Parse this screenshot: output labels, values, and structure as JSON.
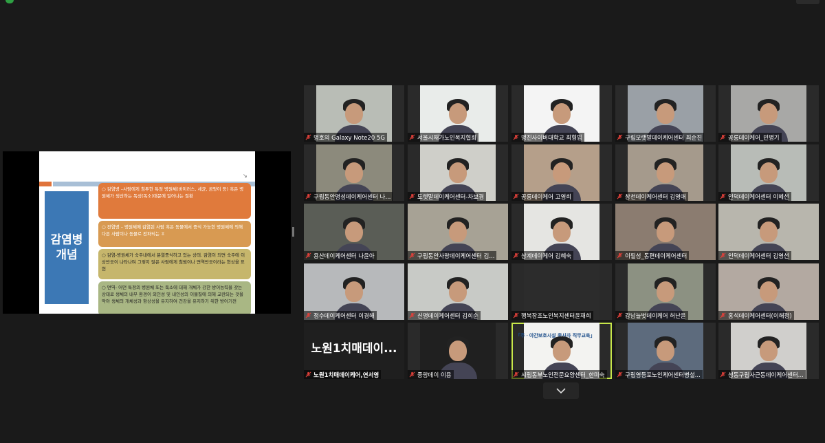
{
  "slide": {
    "title": "감염병\n개념",
    "bullets": [
      "○ 감염병 –사람에게 침투한 특정 병원체(바이러스, 세균, 곰팡이 등) 혹은 병원체가 생산하는 독성(독소)때문에 일어나는 질환",
      "○ 전염병 – 병원체에 감염된 사람 혹은 동물에서 증식 가능한 병원체에 의해 다른 사람이나 동물로 전파되는 ㅎ",
      "○ 감염-병원체가 숙주내에서 분열증식하고 있는 상태. 감염이 되면 숙주에 이상반응이 나타나며 그렇지 않은 사람에게 침범이나 면역반응이라는 현상을 표현",
      "○ 면역- 어떤 특정의 병원체 또는 독소에 대해 개체가 강한 방어능력을 갖는 상태로 생체의 내부 환경이 외인성 및 내인성의 이물질에 의해 교란되는 것을 막아 생체의 개체성과 항상성을 유지하여 건강을 유지하기 위한 방어기전"
    ]
  },
  "participants": [
    {
      "name": "명호의 Galaxy Note20 5G"
    },
    {
      "name": "서울시재가노인복지협회"
    },
    {
      "name": "명진사이버대학교 최형임"
    },
    {
      "name": "구립모랫말데이케어센터 최순진"
    },
    {
      "name": "공릉데이케어_민병기"
    },
    {
      "name": "구립동안명성데이케어센터 나..."
    },
    {
      "name": "도렛말데이케어센터-차보경"
    },
    {
      "name": "공릉데이케어 고영희"
    },
    {
      "name": "창천데이케어센터 김영애"
    },
    {
      "name": "인덕데이케어센터 이혜선"
    },
    {
      "name": "용산데이케어센터 나윤아"
    },
    {
      "name": "구립동안사랑데이케어센터 김..."
    },
    {
      "name": "상계데이케어 김혜숙"
    },
    {
      "name": "이필성_동편데이케어센터"
    },
    {
      "name": "인덕데이케어센터 김영선"
    },
    {
      "name": "정수데이케어센터 이경해"
    },
    {
      "name": "신명데이케어센터 김희순"
    },
    {
      "name": "행복장조노인복지센터윤재희"
    },
    {
      "name": "강남늘벗데이케어 허난윤"
    },
    {
      "name": "홍석데이케어센터(이해정)"
    },
    {
      "name": "노원1치매데이케어,연서영",
      "display_text": "노원1치매데이..."
    },
    {
      "name": "중랑데이 이용"
    },
    {
      "name": "시립동부노인전문요양센터_한미숙",
      "screen_text": "「주ㆍ야간보호시설 종사자 직무교육」"
    },
    {
      "name": "구립영등포노인케어센터병설..."
    },
    {
      "name": "성동구립사근동데이케어센터..."
    }
  ],
  "icons": {
    "mic": "mic-muted-icon",
    "chevron": "chevron-down-icon"
  },
  "colors": {
    "active_speaker": "#c7e64a",
    "muted": "#e0413a"
  }
}
